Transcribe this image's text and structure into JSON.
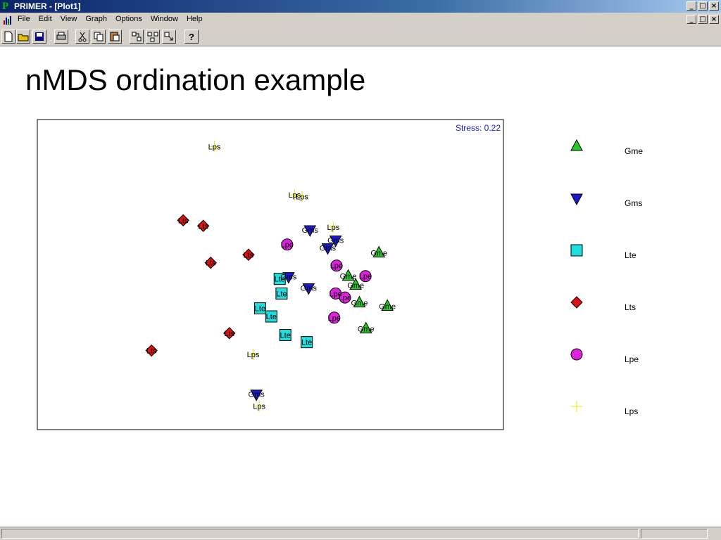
{
  "window": {
    "title": "PRIMER - [Plot1]",
    "app_glyph": "P",
    "controls": [
      "_",
      "□",
      "×"
    ]
  },
  "menu": {
    "items": [
      "File",
      "Edit",
      "View",
      "Graph",
      "Options",
      "Window",
      "Help"
    ]
  },
  "toolbar": {
    "icons": [
      "new-icon",
      "open-icon",
      "save-icon",
      "print-icon",
      "cut-icon",
      "copy-icon",
      "paste-icon",
      "graph-tree-icon",
      "graph-multi-icon",
      "graph-export-icon",
      "help-icon"
    ]
  },
  "slide": {
    "title": "nMDS ordination example"
  },
  "chart_data": {
    "type": "scatter",
    "title": "",
    "annotation": "Stress: 0.22",
    "xlim": [
      0,
      100
    ],
    "ylim": [
      0,
      100
    ],
    "grid": false,
    "legend_placement": "right",
    "colors": {
      "Gme": "#22cc22",
      "Gms": "#1a1acc",
      "Lte": "#22dddd",
      "Lts": "#dd1111",
      "Lpe": "#dd22dd",
      "Lps": "#e8e800"
    },
    "series": [
      {
        "name": "Gme",
        "marker": "triangle-up",
        "points": [
          [
            73.3,
            57.0
          ],
          [
            66.7,
            49.5
          ],
          [
            68.3,
            46.6
          ],
          [
            69.1,
            40.9
          ],
          [
            75.1,
            39.8
          ],
          [
            70.5,
            32.5
          ]
        ]
      },
      {
        "name": "Gms",
        "marker": "triangle-down",
        "points": [
          [
            58.5,
            64.4
          ],
          [
            64.0,
            61.1
          ],
          [
            62.3,
            58.6
          ],
          [
            53.9,
            49.3
          ],
          [
            58.2,
            45.7
          ],
          [
            47.0,
            11.4
          ]
        ]
      },
      {
        "name": "Lte",
        "marker": "square",
        "points": [
          [
            52.0,
            48.6
          ],
          [
            52.4,
            43.9
          ],
          [
            47.8,
            39.1
          ],
          [
            50.2,
            36.5
          ],
          [
            53.2,
            30.5
          ],
          [
            57.8,
            28.2
          ]
        ]
      },
      {
        "name": "Lts",
        "marker": "diamond",
        "points": [
          [
            31.3,
            67.5
          ],
          [
            35.6,
            65.7
          ],
          [
            45.3,
            56.4
          ],
          [
            37.2,
            53.8
          ],
          [
            41.2,
            31.1
          ],
          [
            24.5,
            25.5
          ]
        ]
      },
      {
        "name": "Lpe",
        "marker": "circle",
        "points": [
          [
            53.6,
            59.7
          ],
          [
            64.2,
            52.9
          ],
          [
            70.4,
            49.5
          ],
          [
            64.0,
            43.9
          ],
          [
            66.0,
            42.6
          ],
          [
            63.7,
            36.1
          ]
        ]
      },
      {
        "name": "Lps",
        "marker": "cross",
        "points": [
          [
            38.0,
            91.3
          ],
          [
            55.2,
            75.7
          ],
          [
            56.8,
            75.2
          ],
          [
            63.5,
            65.3
          ],
          [
            46.3,
            24.3
          ],
          [
            47.6,
            7.6
          ]
        ]
      }
    ],
    "labels": [
      {
        "text": "Lps",
        "series": "Lps",
        "x": 38.0,
        "y": 91.3
      },
      {
        "text": "Lps",
        "series": "Lps",
        "x": 55.2,
        "y": 75.7
      },
      {
        "text": "Lps",
        "series": "Lps",
        "x": 56.8,
        "y": 75.2
      },
      {
        "text": "Lps",
        "series": "Lps",
        "x": 63.5,
        "y": 65.3
      },
      {
        "text": "Lps",
        "series": "Lps",
        "x": 46.3,
        "y": 24.3
      },
      {
        "text": "Lps",
        "series": "Lps",
        "x": 47.6,
        "y": 7.6
      },
      {
        "text": "Gms",
        "series": "Gms",
        "x": 58.5,
        "y": 64.4
      },
      {
        "text": "Gms",
        "series": "Gms",
        "x": 64.0,
        "y": 61.1
      },
      {
        "text": "Gms",
        "series": "Gms",
        "x": 62.3,
        "y": 58.6
      },
      {
        "text": "Gms",
        "series": "Gms",
        "x": 53.9,
        "y": 49.3
      },
      {
        "text": "Gms",
        "series": "Gms",
        "x": 58.2,
        "y": 45.7
      },
      {
        "text": "Gms",
        "series": "Gms",
        "x": 47.0,
        "y": 11.4
      },
      {
        "text": "Lpe",
        "series": "Lpe",
        "x": 53.6,
        "y": 59.7
      },
      {
        "text": "Lpe",
        "series": "Lpe",
        "x": 64.2,
        "y": 52.9
      },
      {
        "text": "Lpe",
        "series": "Lpe",
        "x": 70.4,
        "y": 49.5
      },
      {
        "text": "Lpe",
        "series": "Lpe",
        "x": 64.0,
        "y": 43.9
      },
      {
        "text": "Lpe",
        "series": "Lpe",
        "x": 66.0,
        "y": 42.6
      },
      {
        "text": "Lpe",
        "series": "Lpe",
        "x": 63.7,
        "y": 36.1
      },
      {
        "text": "Gme",
        "series": "Gme",
        "x": 73.3,
        "y": 57.0
      },
      {
        "text": "Gme",
        "series": "Gme",
        "x": 66.7,
        "y": 49.5
      },
      {
        "text": "Gme",
        "series": "Gme",
        "x": 68.3,
        "y": 46.6
      },
      {
        "text": "Gme",
        "series": "Gme",
        "x": 69.1,
        "y": 40.9
      },
      {
        "text": "Gme",
        "series": "Gme",
        "x": 75.1,
        "y": 39.8
      },
      {
        "text": "Gme",
        "series": "Gme",
        "x": 70.5,
        "y": 32.5
      },
      {
        "text": "Lte",
        "series": "Lte",
        "x": 52.0,
        "y": 48.6
      },
      {
        "text": "Lte",
        "series": "Lte",
        "x": 52.4,
        "y": 43.9
      },
      {
        "text": "Lte",
        "series": "Lte",
        "x": 47.8,
        "y": 39.1
      },
      {
        "text": "Lte",
        "series": "Lte",
        "x": 50.2,
        "y": 36.5
      },
      {
        "text": "Lte",
        "series": "Lte",
        "x": 53.2,
        "y": 30.5
      },
      {
        "text": "Lte",
        "series": "Lte",
        "x": 57.8,
        "y": 28.2
      },
      {
        "text": "Lts",
        "series": "Lts",
        "x": 31.3,
        "y": 67.5
      },
      {
        "text": "Lts",
        "series": "Lts",
        "x": 35.6,
        "y": 65.7
      },
      {
        "text": "Lts",
        "series": "Lts",
        "x": 45.3,
        "y": 56.4
      },
      {
        "text": "Lts",
        "series": "Lts",
        "x": 37.2,
        "y": 53.8
      },
      {
        "text": "Lts",
        "series": "Lts",
        "x": 41.2,
        "y": 31.1
      },
      {
        "text": "Lts",
        "series": "Lts",
        "x": 24.5,
        "y": 25.5
      }
    ],
    "legend": [
      "Gme",
      "Gms",
      "Lte",
      "Lts",
      "Lpe",
      "Lps"
    ]
  }
}
